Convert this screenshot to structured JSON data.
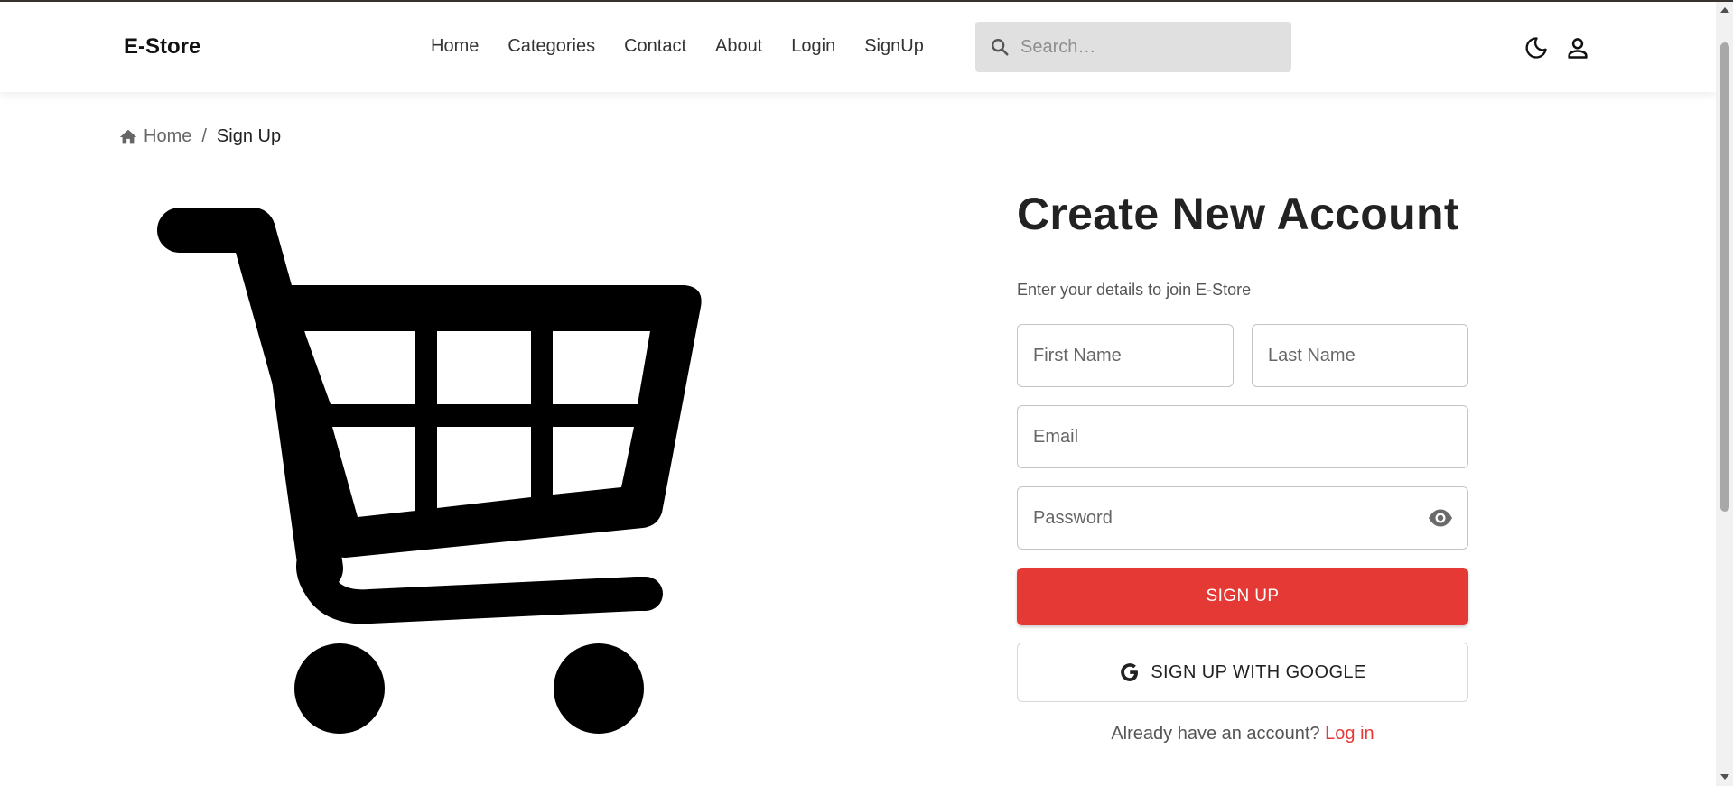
{
  "navbar": {
    "brand": "E-Store",
    "links": [
      "Home",
      "Categories",
      "Contact",
      "About",
      "Login",
      "SignUp"
    ],
    "search_placeholder": "Search…",
    "icons": {
      "search": "search-icon",
      "theme": "moon-icon",
      "account": "user-icon"
    }
  },
  "breadcrumb": {
    "home": "Home",
    "separator": "/",
    "current": "Sign Up",
    "home_icon": "home-icon"
  },
  "hero": {
    "image": "shopping-cart-icon"
  },
  "form": {
    "title": "Create New Account",
    "subtitle": "Enter your details to join E-Store",
    "first_name_placeholder": "First Name",
    "last_name_placeholder": "Last Name",
    "email_placeholder": "Email",
    "password_placeholder": "Password",
    "signup_label": "SIGN UP",
    "google_label": "SIGN UP WITH GOOGLE",
    "login_prompt": "Already have an account?",
    "login_link": "Log in"
  },
  "colors": {
    "accent": "#e53935",
    "search_bg": "#e0e0e0",
    "text": "#222222"
  }
}
